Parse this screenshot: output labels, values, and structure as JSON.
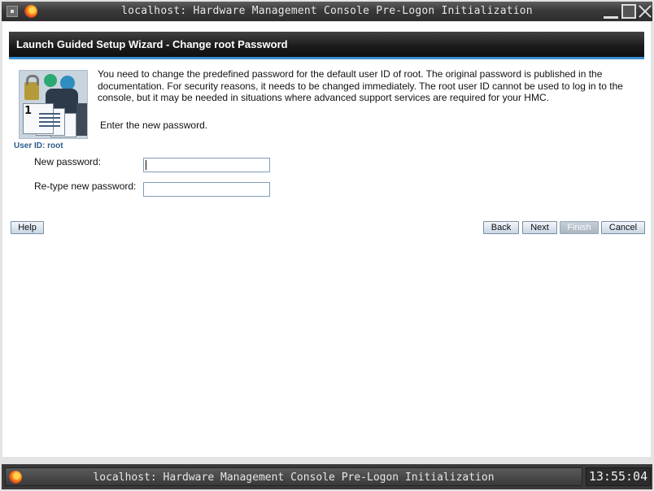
{
  "window": {
    "title": "localhost: Hardware Management Console Pre-Logon Initialization"
  },
  "wizard": {
    "title": "Launch Guided Setup Wizard - Change root Password",
    "user_id_label": "User ID: root",
    "description": "You need to change the predefined password for the default user ID of root. The original password is published in the documentation. For security reasons, it needs to be changed immediately. The root user ID cannot be used to log in to the console, but it may be needed in situations where advanced support services are required for your HMC.",
    "prompt": "Enter the new password.",
    "fields": {
      "new_password_label": "New password:",
      "new_password_value": "",
      "retype_password_label": "Re-type new password:",
      "retype_password_value": ""
    },
    "buttons": {
      "help": "Help",
      "back": "Back",
      "next": "Next",
      "finish": "Finish",
      "cancel": "Cancel"
    }
  },
  "taskbar": {
    "task_title": "localhost: Hardware Management Console Pre-Logon Initialization",
    "clock": "13:55:04"
  },
  "colors": {
    "banner_accent": "#3c8fd6",
    "user_id_color": "#2d5b8c"
  },
  "icons": [
    "window-menu-icon",
    "firefox-icon",
    "minimize-icon",
    "maximize-icon",
    "close-icon",
    "password-wizard-icon"
  ]
}
